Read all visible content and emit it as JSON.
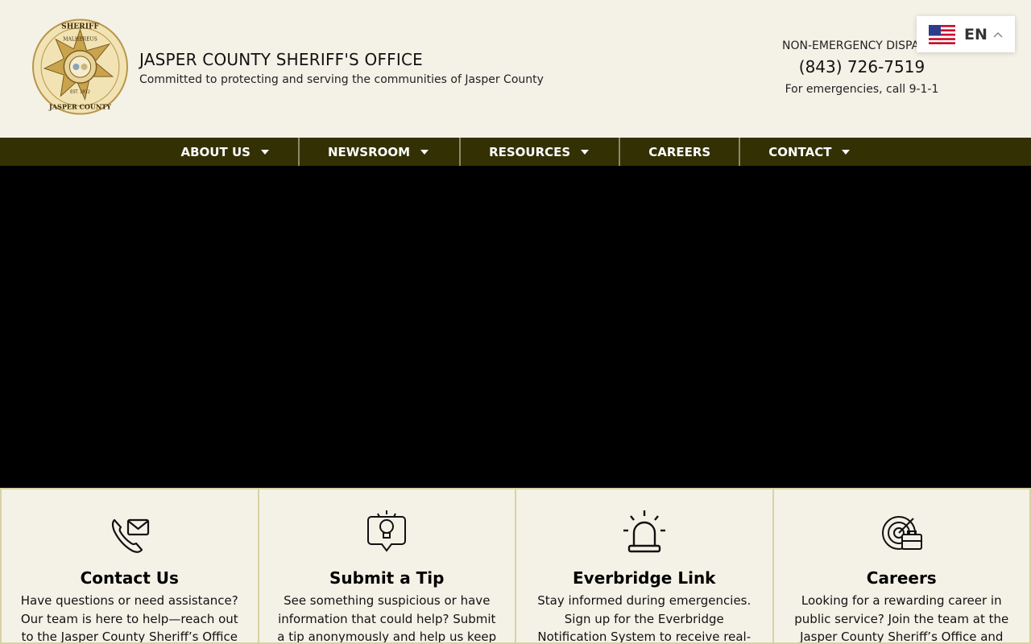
{
  "header": {
    "logo_text_top": "SHERIFF",
    "logo_text_motto": "MALHEREUS",
    "logo_text_bottom": "JASPER COUNTY",
    "logo_text_est": "EST. 1912",
    "title": "JASPER COUNTY SHERIFF'S OFFICE",
    "subtitle": "Committed to protecting and serving the communities of Jasper County",
    "dispatch_label": "NON-EMERGENCY DISPATCH",
    "dispatch_phone": "(843) 726-7519",
    "dispatch_note": "For emergencies, call 9-1-1"
  },
  "language": {
    "code": "EN",
    "flag_icon": "us-flag-icon"
  },
  "nav": {
    "items": [
      {
        "label": "ABOUT US",
        "has_dropdown": true
      },
      {
        "label": "NEWSROOM",
        "has_dropdown": true
      },
      {
        "label": "RESOURCES",
        "has_dropdown": true
      },
      {
        "label": "CAREERS",
        "has_dropdown": false
      },
      {
        "label": "CONTACT",
        "has_dropdown": true
      }
    ]
  },
  "cards": [
    {
      "icon": "phone-mail-icon",
      "title": "Contact Us",
      "text": "Have questions or need assistance? Our team is here to help—reach out to the Jasper County Sheriff’s Office"
    },
    {
      "icon": "lightbulb-tip-icon",
      "title": "Submit a Tip",
      "text": "See something suspicious or have information that could help? Submit a tip anonymously and help us keep"
    },
    {
      "icon": "siren-icon",
      "title": "Everbridge Link",
      "text": "Stay informed during emergencies. Sign up for the Everbridge Notification System to receive real-"
    },
    {
      "icon": "target-briefcase-icon",
      "title": "Careers",
      "text": "Looking for a rewarding career in public service? Join the team at the Jasper County Sheriff’s Office and"
    }
  ],
  "colors": {
    "background": "#f4f2e7",
    "nav_bar": "#333004",
    "card_border": "#d8d2a3",
    "hero": "#000000"
  }
}
